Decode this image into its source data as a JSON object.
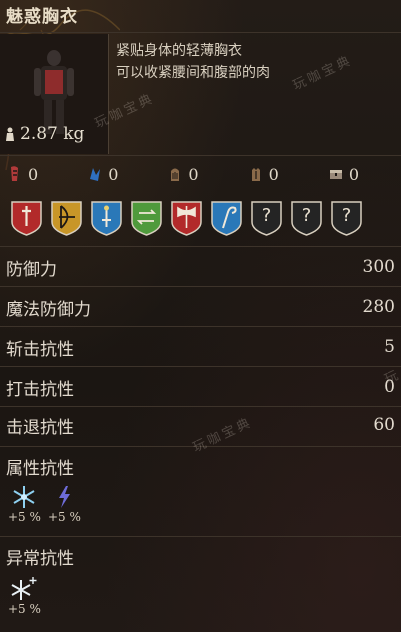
{
  "item": {
    "name": "魅惑胸衣",
    "description": "紧贴身体的轻薄胸衣\n可以收紧腰间和腹部的肉",
    "weight": "2.87 kg"
  },
  "attribute_requirements": [
    {
      "icon": "strength-icon",
      "value": "0"
    },
    {
      "icon": "dexterity-icon",
      "value": "0"
    },
    {
      "icon": "intelligence-icon",
      "value": "0"
    },
    {
      "icon": "faith-icon",
      "value": "0"
    },
    {
      "icon": "arcane-icon",
      "value": "0"
    }
  ],
  "damage_types": [
    {
      "icon": "dagger-icon",
      "color": "#b22a2a",
      "known": true
    },
    {
      "icon": "bow-icon",
      "color": "#c89628",
      "known": true
    },
    {
      "icon": "sword-icon",
      "color": "#2a78b8",
      "known": true
    },
    {
      "icon": "arrows-icon",
      "color": "#4f9a3c",
      "known": true
    },
    {
      "icon": "axe-icon",
      "color": "#b22a2a",
      "known": true
    },
    {
      "icon": "hook-icon",
      "color": "#2a78b8",
      "known": true
    },
    {
      "icon": "question-icon",
      "color": "#2a2a2a",
      "known": false,
      "label": "?"
    },
    {
      "icon": "question-icon",
      "color": "#2a2a2a",
      "known": false,
      "label": "?"
    },
    {
      "icon": "question-icon",
      "color": "#2a2a2a",
      "known": false,
      "label": "?"
    }
  ],
  "stats": [
    {
      "label": "防御力",
      "value": "300"
    },
    {
      "label": "魔法防御力",
      "value": "280"
    },
    {
      "label": "斩击抗性",
      "value": "5"
    },
    {
      "label": "打击抗性",
      "value": "0"
    },
    {
      "label": "击退抗性",
      "value": "60"
    }
  ],
  "elemental_resistance": {
    "title": "属性抗性",
    "items": [
      {
        "icon": "frost-icon",
        "value": "+5 %"
      },
      {
        "icon": "lightning-icon",
        "value": "+5 %"
      }
    ]
  },
  "status_resistance": {
    "title": "异常抗性",
    "items": [
      {
        "icon": "frostbite-icon",
        "value": "+5 %"
      }
    ]
  },
  "watermarks": [
    "玩咖宝典",
    "玩咖宝典",
    "玩咖宝典",
    "玩"
  ]
}
